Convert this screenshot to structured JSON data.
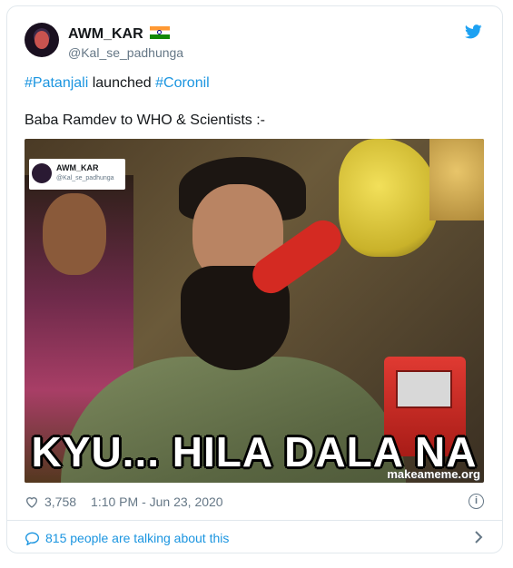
{
  "tweet": {
    "author": {
      "name": "AWM_KAR",
      "handle": "@Kal_se_padhunga",
      "flag_icon": "india-flag-icon"
    },
    "text": {
      "hashtag1": "#Patanjali",
      "mid": " launched ",
      "hashtag2": "#Coronil",
      "line2": "Baba Ramdev to WHO & Scientists :-"
    },
    "media": {
      "watermark_name": "AWM_KAR",
      "watermark_handle": "@Kal_se_padhunga",
      "caption": "KYU... HILA DALA NA",
      "generator": "makeameme.org"
    },
    "likes": "3,758",
    "timestamp": "1:10 PM - Jun 23, 2020",
    "talking": "815 people are talking about this"
  },
  "colors": {
    "link": "#1b95e0",
    "muted": "#657786",
    "twitter_blue": "#1da1f2"
  },
  "icons": [
    "twitter-bird-icon",
    "heart-icon",
    "info-icon",
    "speech-bubble-icon",
    "chevron-right-icon"
  ]
}
